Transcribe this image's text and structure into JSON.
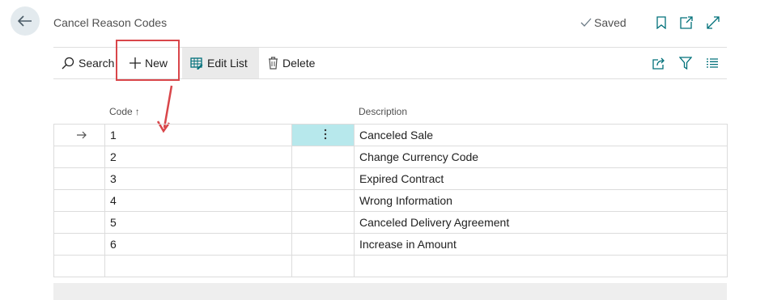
{
  "header": {
    "title": "Cancel Reason Codes",
    "saved_label": "Saved"
  },
  "actions": {
    "search": "Search",
    "new": "New",
    "edit_list": "Edit List",
    "delete": "Delete"
  },
  "columns": {
    "code": "Code",
    "code_sort": "↑",
    "description": "Description"
  },
  "rows": [
    {
      "code": "1",
      "description": "Canceled Sale"
    },
    {
      "code": "2",
      "description": "Change Currency Code"
    },
    {
      "code": "3",
      "description": "Expired Contract"
    },
    {
      "code": "4",
      "description": "Wrong Information"
    },
    {
      "code": "5",
      "description": "Canceled Delivery Agreement"
    },
    {
      "code": "6",
      "description": "Increase in Amount"
    }
  ],
  "icons": {
    "back": "arrow-left-icon",
    "saved": "checkmark-icon",
    "bookmark": "bookmark-icon",
    "open_new_window": "open-in-new-window-icon",
    "expand": "expand-icon",
    "search": "search-icon",
    "new": "plus-icon",
    "edit_list": "edit-list-icon",
    "delete": "trash-icon",
    "share": "share-icon",
    "filter": "filter-icon",
    "list_view": "list-view-icon",
    "row_selected": "arrow-right-icon",
    "row_menu": "more-vertical-icon"
  },
  "colors": {
    "accent": "#00707a",
    "callout": "#d9464a",
    "selected_cell": "#b7e8ec",
    "toolbar_pressed": "#eaeaea"
  }
}
